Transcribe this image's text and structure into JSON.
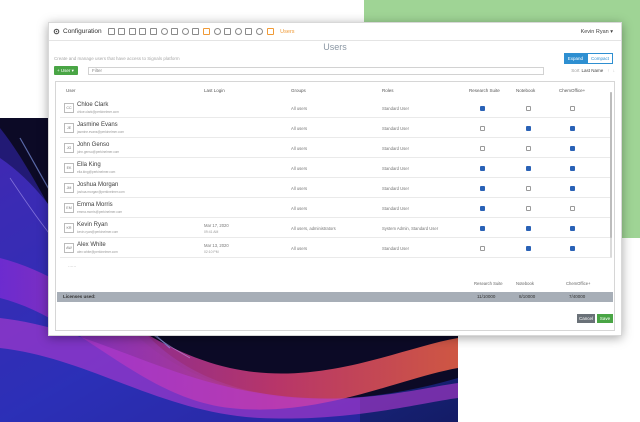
{
  "colors": {
    "accent_blue": "#2e8fd1",
    "checkbox_blue": "#2a62b6",
    "green": "#49a545",
    "tool_orange": "#f09a36",
    "license_bar": "#a7aeb7",
    "bg_green": "#9fd495"
  },
  "topbar": {
    "app_title": "Configuration",
    "active_section": "Users",
    "user_menu": "Kevin Ryan ▾"
  },
  "page": {
    "title": "Users",
    "subtitle": "Create and manage users that have access to Signals platform"
  },
  "view_toggle": {
    "options": [
      "Expand",
      "Compact"
    ],
    "selected": "Expand"
  },
  "toolbar": {
    "add_label": "+ User ▾",
    "filter_placeholder": "Filter",
    "sort_label": "Sort",
    "sort_value": "Last Name",
    "sort_arrows": "↑ ↓"
  },
  "table": {
    "headers": {
      "user": "User",
      "last_login": "Last Login",
      "groups": "Groups",
      "roles": "Roles",
      "research_suite": "Research Suite",
      "notebook": "Notebook",
      "chemoffice": "ChemOffice+"
    },
    "rows": [
      {
        "initials": "CC",
        "name": "Chloe Clark",
        "email": "chloe.clark@perkinelmer.com",
        "login_date": "",
        "login_time": "",
        "groups": "All users",
        "roles": "Standard User",
        "research_suite": true,
        "notebook": false,
        "chemoffice": false
      },
      {
        "initials": "JE",
        "name": "Jasmine Evans",
        "email": "jasmine.evans@perkinelmer.com",
        "login_date": "",
        "login_time": "",
        "groups": "All users",
        "roles": "Standard User",
        "research_suite": false,
        "notebook": true,
        "chemoffice": true
      },
      {
        "initials": "JG",
        "name": "John Genso",
        "email": "john.genso@perkinelmer.com",
        "login_date": "",
        "login_time": "",
        "groups": "All users",
        "roles": "Standard User",
        "research_suite": false,
        "notebook": false,
        "chemoffice": true
      },
      {
        "initials": "EK",
        "name": "Ella King",
        "email": "ella.king@perkinelmer.com",
        "login_date": "",
        "login_time": "",
        "groups": "All users",
        "roles": "Standard User",
        "research_suite": true,
        "notebook": true,
        "chemoffice": true
      },
      {
        "initials": "JM",
        "name": "Joshua Morgan",
        "email": "joshua.morgan@perkinelmer.com",
        "login_date": "",
        "login_time": "",
        "groups": "All users",
        "roles": "Standard User",
        "research_suite": true,
        "notebook": false,
        "chemoffice": true
      },
      {
        "initials": "EM",
        "name": "Emma Morris",
        "email": "emma.morris@perkinelmer.com",
        "login_date": "",
        "login_time": "",
        "groups": "All users",
        "roles": "Standard User",
        "research_suite": true,
        "notebook": false,
        "chemoffice": false
      },
      {
        "initials": "KR",
        "name": "Kevin Ryan",
        "email": "kevin.ryan@perkinelmer.com",
        "login_date": "Mar 17, 2020",
        "login_time": "09:41 AM",
        "groups": "All users, administrators",
        "roles": "System Admin, Standard User",
        "research_suite": true,
        "notebook": true,
        "chemoffice": true
      },
      {
        "initials": "AW",
        "name": "Alex White",
        "email": "alex.white@perkinelmer.com",
        "login_date": "Mar 13, 2020",
        "login_time": "02:10 PM",
        "groups": "All users",
        "roles": "Standard User",
        "research_suite": false,
        "notebook": true,
        "chemoffice": true
      }
    ],
    "more_indicator": "......"
  },
  "licenses": {
    "headers": {
      "research_suite": "Research Suite",
      "notebook": "Notebook",
      "chemoffice": "ChemOffice+"
    },
    "label": "Licenses used:",
    "research_suite": "11/10000",
    "notebook": "8/10000",
    "chemoffice": "7/40000"
  },
  "footer": {
    "cancel_label": "Cancel",
    "save_label": "Save"
  }
}
